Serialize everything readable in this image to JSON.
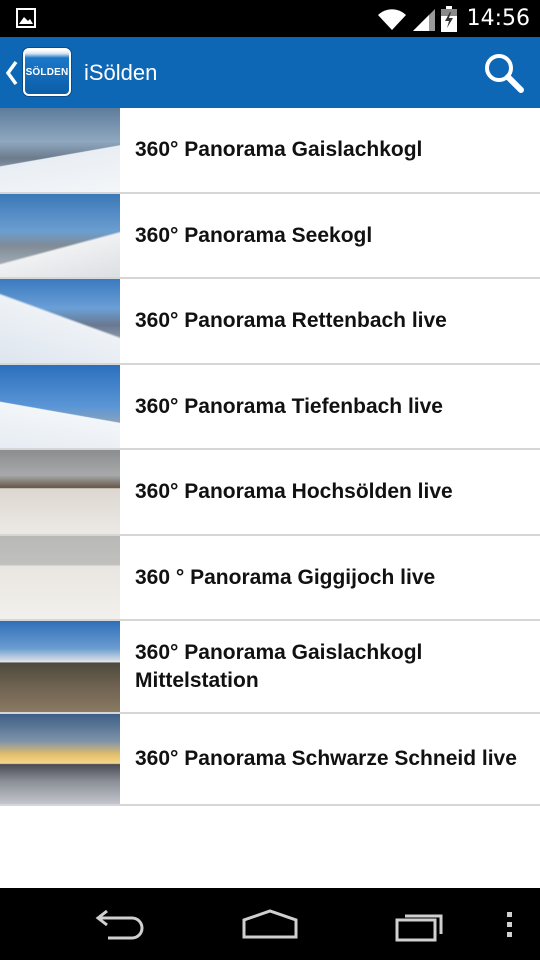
{
  "status_bar": {
    "time": "14:56",
    "icons": [
      "gallery-notification-icon",
      "wifi-icon",
      "signal-icon",
      "battery-icon"
    ]
  },
  "action_bar": {
    "logo_text": "SÖLDEN",
    "title": "iSölden",
    "icons": [
      "back-chevron-icon",
      "search-icon"
    ]
  },
  "list": {
    "items": [
      {
        "label": "360° Panorama Gaislachkogl"
      },
      {
        "label": "360° Panorama Seekogl"
      },
      {
        "label": "360° Panorama Rettenbach live"
      },
      {
        "label": "360° Panorama Tiefenbach live"
      },
      {
        "label": "360° Panorama Hochsölden live"
      },
      {
        "label": "360 ° Panorama Giggijoch live"
      },
      {
        "label": "360° Panorama Gaislachkogl Mittelstation"
      },
      {
        "label": "360° Panorama Schwarze Schneid live"
      }
    ]
  },
  "nav_bar": {
    "icons": [
      "back-icon",
      "home-icon",
      "recent-apps-icon",
      "overflow-menu-icon"
    ]
  },
  "colors": {
    "action_bar": "#0d67b5",
    "list_background": "#ffffff",
    "divider": "#d6d6d6",
    "system_bars": "#000000"
  }
}
